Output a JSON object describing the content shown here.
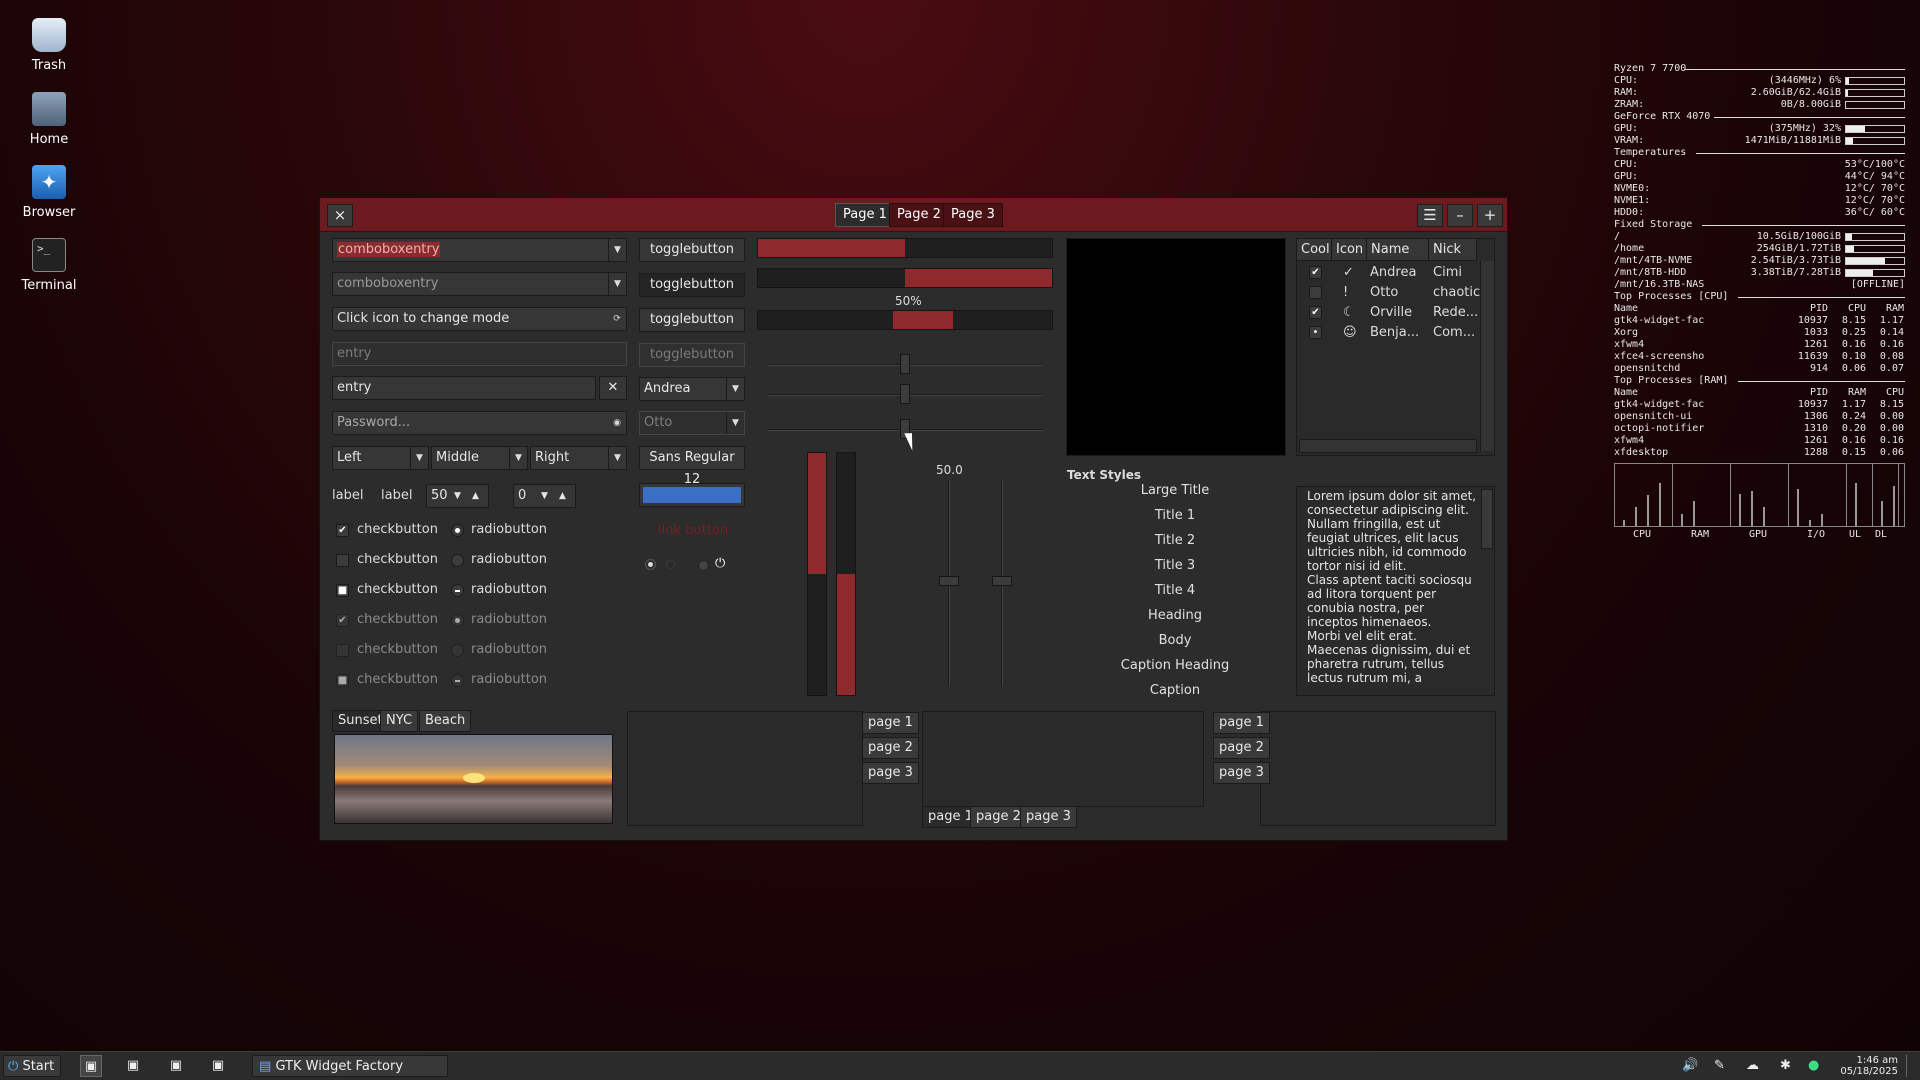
{
  "desktop": {
    "icons": [
      {
        "label": "Trash"
      },
      {
        "label": "Home"
      },
      {
        "label": "Browser"
      },
      {
        "label": "Terminal"
      }
    ]
  },
  "window": {
    "title_tabs": [
      "Page 1",
      "Page 2",
      "Page 3"
    ],
    "col1": {
      "combo1": "comboboxentry",
      "combo2": "comboboxentry",
      "mode_entry": "Click icon to change mode",
      "entry_disabled": "entry",
      "entry_clear": "entry",
      "password_placeholder": "Password...",
      "align_left": "Left",
      "align_middle": "Middle",
      "align_right": "Right",
      "label1": "label",
      "label2": "label",
      "spin1": "50",
      "spin2": "0",
      "checkbutton": "checkbutton",
      "radiobutton": "radiobutton",
      "image_tabs": [
        "Sunset",
        "NYC",
        "Beach"
      ]
    },
    "col2": {
      "togglebutton": "togglebutton",
      "combo_andrea": "Andrea",
      "combo_otto": "Otto",
      "font_button": "Sans Regular 12",
      "link_button": "link button",
      "color_button": "#3a6fc4"
    },
    "progress": {
      "bar1": 0.5,
      "bar2_start": 0.5,
      "pulse_label": "50%",
      "vscale_label": "50.0"
    },
    "text_styles": {
      "heading": "Text Styles",
      "items": [
        "Large Title",
        "Title 1",
        "Title 2",
        "Title 3",
        "Title 4",
        "Heading",
        "Body",
        "Caption Heading",
        "Caption"
      ]
    },
    "tree": {
      "columns": [
        "Cool",
        "Icon",
        "Name",
        "Nick"
      ],
      "rows": [
        {
          "cool": "✔",
          "icon": "✓",
          "name": "Andrea",
          "nick": "Cimi"
        },
        {
          "cool": "",
          "icon": "!",
          "name": "Otto",
          "nick": "chaotic"
        },
        {
          "cool": "✔",
          "icon": "☾",
          "name": "Orville",
          "nick": "Rede..."
        },
        {
          "cool": "•",
          "icon": "☺",
          "name": "Benja...",
          "nick": "Com..."
        }
      ]
    },
    "textview": "Lorem ipsum dolor sit amet, consectetur adipiscing elit.\nNullam fringilla, est ut feugiat ultrices, elit lacus ultricies nibh, id commodo tortor nisi id elit.\nClass aptent taciti sociosqu ad litora torquent per conubia nostra, per inceptos himenaeos.\nMorbi vel elit erat.\nMaecenas dignissim, dui et pharetra rutrum, tellus lectus rutrum mi, a",
    "notebook_tabs": [
      "page 1",
      "page 2",
      "page 3"
    ]
  },
  "conky": {
    "cpu_name": "Ryzen 7 7700",
    "cpu": {
      "label": "CPU:",
      "value": "(3446MHz) 6%",
      "pct": 6
    },
    "ram": {
      "label": "RAM:",
      "value": "2.60GiB/62.4GiB",
      "pct": 4
    },
    "zram": {
      "label": "ZRAM:",
      "value": "0B/8.00GiB",
      "pct": 0
    },
    "gpu_name": "GeForce RTX 4070",
    "gpu": {
      "label": "GPU:",
      "value": "(375MHz) 32%",
      "pct": 32
    },
    "vram": {
      "label": "VRAM:",
      "value": "1471MiB/11881MiB",
      "pct": 12
    },
    "temps_header": "Temperatures",
    "temps": [
      {
        "label": "CPU:",
        "value": "53°C/100°C"
      },
      {
        "label": "GPU:",
        "value": "44°C/ 94°C"
      },
      {
        "label": "NVME0:",
        "value": "12°C/ 70°C"
      },
      {
        "label": "NVME1:",
        "value": "12°C/ 70°C"
      },
      {
        "label": "HDD0:",
        "value": "36°C/ 60°C"
      }
    ],
    "storage_header": "Fixed Storage",
    "storage": [
      {
        "label": "/",
        "value": "10.5GiB/100GiB",
        "pct": 10
      },
      {
        "label": "/home",
        "value": "254GiB/1.72TiB",
        "pct": 14
      },
      {
        "label": "/mnt/4TB-NVME",
        "value": "2.54TiB/3.73TiB",
        "pct": 68
      },
      {
        "label": "/mnt/8TB-HDD",
        "value": "3.38TiB/7.28TiB",
        "pct": 46
      },
      {
        "label": "/mnt/16.3TB-NAS",
        "value": "[OFFLINE]"
      }
    ],
    "top_cpu_header": "Top Processes [CPU]",
    "top_cpu_cols": [
      "Name",
      "PID",
      "CPU",
      "RAM"
    ],
    "top_cpu": [
      [
        "gtk4-widget-fac",
        "10937",
        "8.15",
        "1.17"
      ],
      [
        "Xorg",
        "1033",
        "0.25",
        "0.14"
      ],
      [
        "xfwm4",
        "1261",
        "0.16",
        "0.16"
      ],
      [
        "xfce4-screensho",
        "11639",
        "0.10",
        "0.08"
      ],
      [
        "opensnitchd",
        "914",
        "0.06",
        "0.07"
      ]
    ],
    "top_ram_header": "Top Processes [RAM]",
    "top_ram_cols": [
      "Name",
      "PID",
      "RAM",
      "CPU"
    ],
    "top_ram": [
      [
        "gtk4-widget-fac",
        "10937",
        "1.17",
        "8.15"
      ],
      [
        "opensnitch-ui",
        "1306",
        "0.24",
        "0.00"
      ],
      [
        "octopi-notifier",
        "1310",
        "0.20",
        "0.00"
      ],
      [
        "xfwm4",
        "1261",
        "0.16",
        "0.16"
      ],
      [
        "xfdesktop",
        "1288",
        "0.15",
        "0.06"
      ]
    ],
    "graph_labels": [
      "CPU",
      "RAM",
      "GPU",
      "I/O",
      "UL",
      "DL"
    ]
  },
  "taskbar": {
    "start": "Start",
    "app": "GTK Widget Factory",
    "time": "1:46 am",
    "date": "05/18/2025"
  }
}
